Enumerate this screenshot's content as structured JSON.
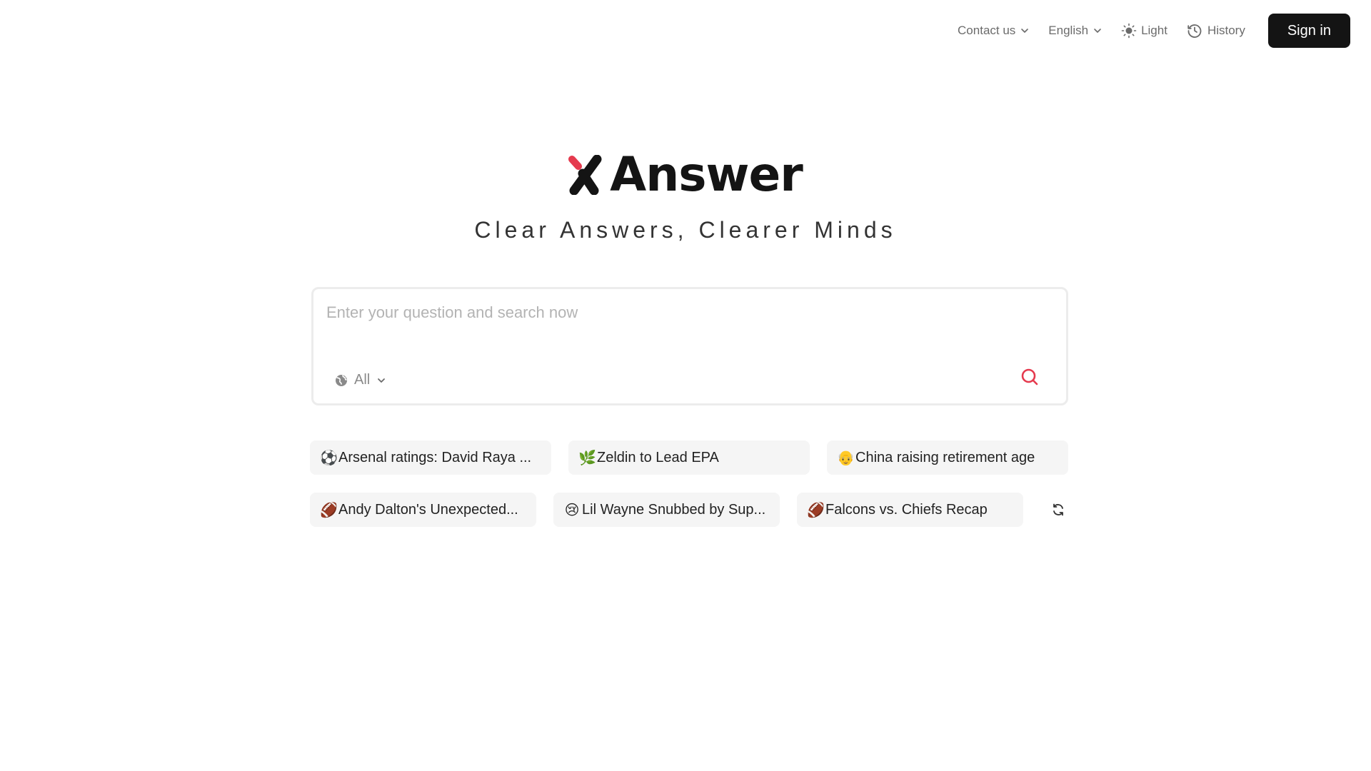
{
  "header": {
    "contact": "Contact us",
    "language": "English",
    "theme": "Light",
    "history": "History",
    "signin": "Sign in"
  },
  "brand": {
    "name": "Answer",
    "tagline": "Clear Answers, Clearer Minds",
    "accent_color": "#e53a4e",
    "dark_color": "#141414"
  },
  "search": {
    "placeholder": "Enter your question and search now",
    "value": "",
    "scope": "All"
  },
  "suggestions": {
    "row1": [
      {
        "emoji": "⚽",
        "text": "Arsenal ratings: David Raya ..."
      },
      {
        "emoji": "🌿",
        "text": "Zeldin to Lead EPA"
      },
      {
        "emoji": "👴",
        "text": "China raising retirement age"
      }
    ],
    "row2": [
      {
        "emoji": "🏈",
        "text": "Andy Dalton's Unexpected..."
      },
      {
        "emoji": "😢",
        "text": "Lil Wayne Snubbed by Sup..."
      },
      {
        "emoji": "🏈",
        "text": "Falcons vs. Chiefs Recap"
      }
    ]
  }
}
